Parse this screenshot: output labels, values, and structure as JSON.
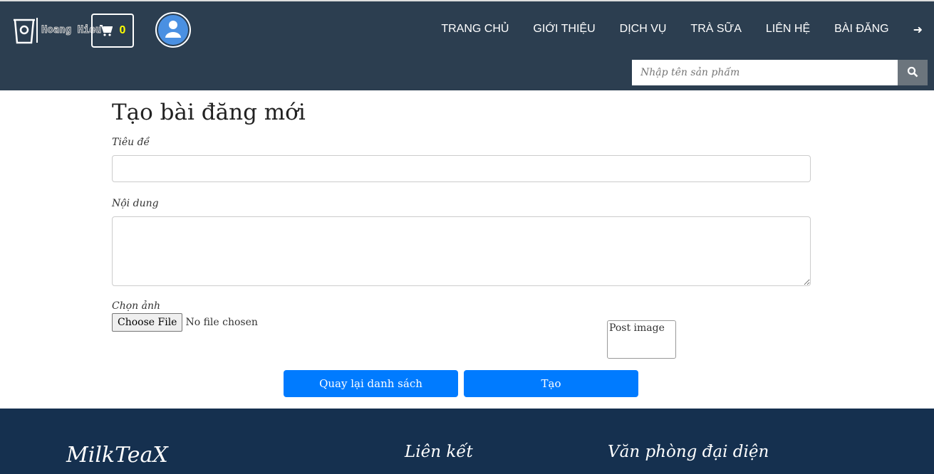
{
  "header": {
    "logo_text": "Hoang Hieu",
    "cart_count": "0",
    "nav": [
      "TRANG CHỦ",
      "GIỚI THIỆU",
      "DỊCH VỤ",
      "TRÀ SỮA",
      "LIÊN HỆ",
      "BÀI ĐĂNG"
    ],
    "search_placeholder": "Nhập tên sản phẩm"
  },
  "form": {
    "title": "Tạo bài đăng mới",
    "title_label": "Tiêu đề",
    "content_label": "Nội dung",
    "image_label": "Chọn ảnh",
    "choose_file": "Choose File",
    "no_file": "No file chosen",
    "image_alt": "Post image",
    "back_button": "Quay lại danh sách",
    "create_button": "Tạo"
  },
  "footer": {
    "brand": "MilkTeaX",
    "links_title": "Liên kết",
    "office_title": "Văn phòng đại diện"
  }
}
